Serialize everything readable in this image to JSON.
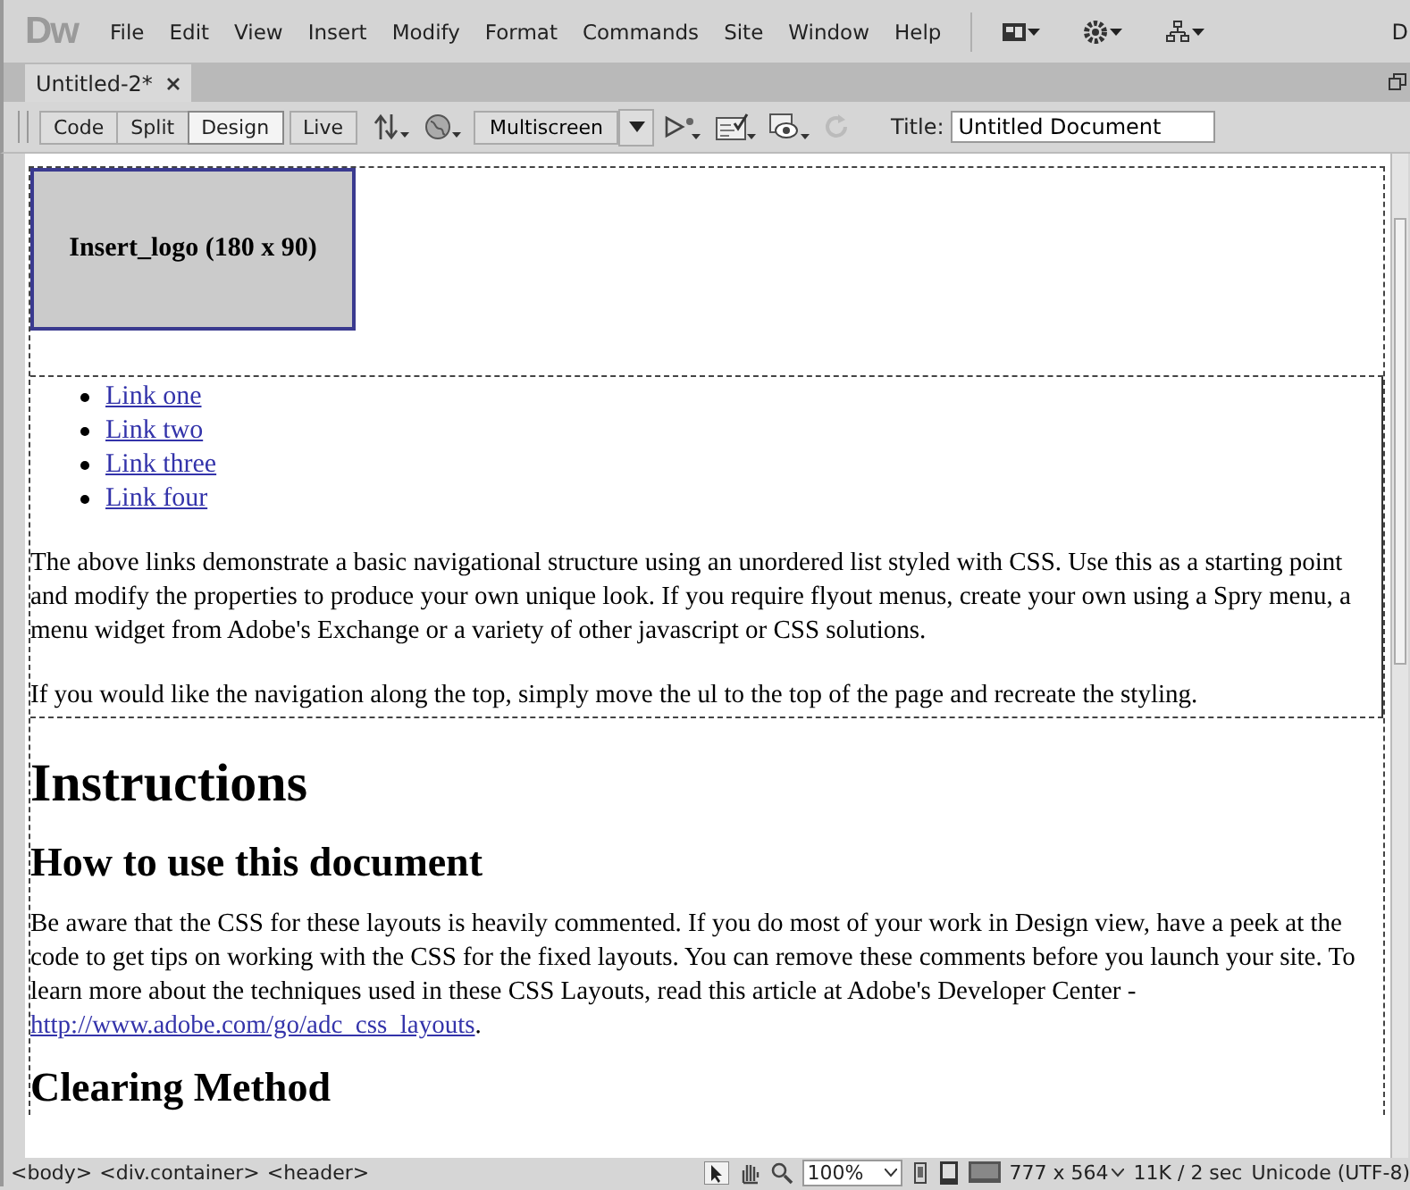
{
  "app": {
    "logo": "Dw",
    "menu": [
      "File",
      "Edit",
      "View",
      "Insert",
      "Modify",
      "Format",
      "Commands",
      "Site",
      "Window",
      "Help"
    ],
    "clipped_label": "D"
  },
  "tabs": [
    {
      "label": "Untitled-2*",
      "selected": true
    }
  ],
  "toolbar": {
    "views": [
      {
        "label": "Code",
        "selected": false
      },
      {
        "label": "Split",
        "selected": false
      },
      {
        "label": "Design",
        "selected": true
      },
      {
        "label": "Live",
        "selected": false
      }
    ],
    "multiscreen": "Multiscreen",
    "title_label": "Title:",
    "title_value": "Untitled Document"
  },
  "document": {
    "logo_placeholder": "Insert_logo (180 x 90)",
    "nav_links": [
      "Link one",
      "Link two",
      "Link three",
      "Link four"
    ],
    "nav_paragraphs": [
      "The above links demonstrate a basic navigational structure using an unordered list styled with CSS. Use this as a starting point and modify the properties to produce your own unique look. If you require flyout menus, create your own using a Spry menu, a menu widget from Adobe's Exchange or a variety of other javascript or CSS solutions.",
      "If you would like the navigation along the top, simply move the ul to the top of the page and recreate the styling."
    ],
    "title": "Instructions",
    "sections": [
      {
        "heading": "How to use this document",
        "text": "Be aware that the CSS for these layouts is heavily commented. If you do most of your work in Design view, have a peek at the code to get tips on working with the CSS for the fixed layouts. You can remove these comments before you launch your site. To learn more about the techniques used in these CSS Layouts, read this article at Adobe's Developer Center - ",
        "link": "http://www.adobe.com/go/adc_css_layouts",
        "after": "."
      },
      {
        "heading": "Clearing Method"
      }
    ]
  },
  "status_bar": {
    "tags": [
      "<body>",
      "<div.container>",
      "<header>"
    ],
    "zoom": "100%",
    "size": "777 x 564",
    "download": "11K / 2 sec",
    "encoding": "Unicode (UTF-8)"
  }
}
